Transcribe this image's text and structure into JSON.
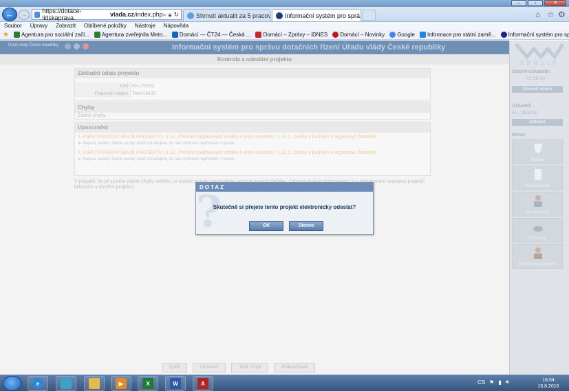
{
  "browser": {
    "url_prefix": "https://dotace-lidskaprava.",
    "url_domain": "vlada.cz",
    "url_path": "/index.php",
    "tabs": [
      {
        "label": "Shrnutí aktualit za 5 pracovníc...",
        "active": false
      },
      {
        "label": "Informační systém pro sprá...",
        "active": true
      }
    ],
    "tab_close": "×"
  },
  "menubar": [
    "Soubor",
    "Úpravy",
    "Zobrazit",
    "Oblíbené položky",
    "Nástroje",
    "Nápověda"
  ],
  "favorites": [
    {
      "label": "Agentura pro sociální začl...",
      "color": "#2e7d32"
    },
    {
      "label": "Agentura zveřejnila Meto...",
      "color": "#2e7d32"
    },
    {
      "label": "Domácí — ČT24 — Česká ...",
      "color": "#1565c0"
    },
    {
      "label": "Domácí – Zprávy – iDNES",
      "color": "#c62828"
    },
    {
      "label": "Domácí – Novinky",
      "color": "#b71c1c"
    },
    {
      "label": "Google",
      "color": "#4285f4"
    },
    {
      "label": "Informace pro státní zamě...",
      "color": "#1e88e5"
    },
    {
      "label": "Informační systém pro spr...",
      "color": "#1a237e"
    }
  ],
  "page": {
    "org": "Úřad vlády České republiky",
    "title": "Informační systém pro správu dotačních řízení Úřadu vlády České republiky",
    "subtitle": "Kontrola a odeslání projektu",
    "basic": {
      "header": "Základní údaje projektu",
      "rows": [
        {
          "k": "Kód",
          "v": "KK170002"
        },
        {
          "k": "Pracovní název",
          "v": "Test KKKO"
        }
      ]
    },
    "errors": {
      "header": "Chyby",
      "text": "Žádné chyby."
    },
    "warnings": {
      "header": "Upozornění",
      "items": [
        {
          "title": "1. IDENTIFIKAČNÍ ÚDAJE PROJEKTU / 1.12. Přehled majetkových vztahů k jiným osobám / 1.12.1. Osoby s podílem v organizaci žadatele",
          "note": "► Nejsou zadány žádné osoby, tudíž označujete, že tato možnost nepřichází v úvahu."
        },
        {
          "title": "1. IDENTIFIKAČNÍ ÚDAJE PROJEKTU / 1.12. Přehled majetkových vztahů k jiným osobám / 1.12.2. Osoby s podílem v organizaci žadatele",
          "note": "► Nejsou zadány žádné osoby, tudíž označujete, že tato možnost nepřichází v úvahu."
        }
      ]
    },
    "para": "V případě, že již systém žádné chyby nehlásí, je možné projekt elektronicky odeslat pomocí tlačítka „Odeslat projekt elektronicky\" a v zobrazeném seznamu projektů kliknutím u daného projektu.",
    "bottom_buttons": [
      "Zpět",
      "Obnovit",
      "Tisk chyb",
      "Pokračovat"
    ]
  },
  "sidebar": {
    "logo_text": "SERVIS",
    "session_label": "Sezení uživatele:",
    "session_value": "01:59:24",
    "session_button": "Obnovit sezení",
    "user_label": "Uživatel:",
    "user_value": "KL_DEMO0",
    "logout_button": "Odhlásit",
    "menu_label": "Menu:",
    "menu_items": [
      "Dotace",
      "Nová žádost",
      "Mé projekty",
      "Kontakty",
      "Technická podpora"
    ]
  },
  "dialog": {
    "title": "DOTAZ",
    "glyph": "?",
    "message": "Skutečně si přejete tento projekt elektronicky odeslat?",
    "ok": "OK",
    "cancel": "Storno"
  },
  "taskbar": {
    "lang": "CS",
    "time": "16:54",
    "date": "16.8.2016"
  }
}
